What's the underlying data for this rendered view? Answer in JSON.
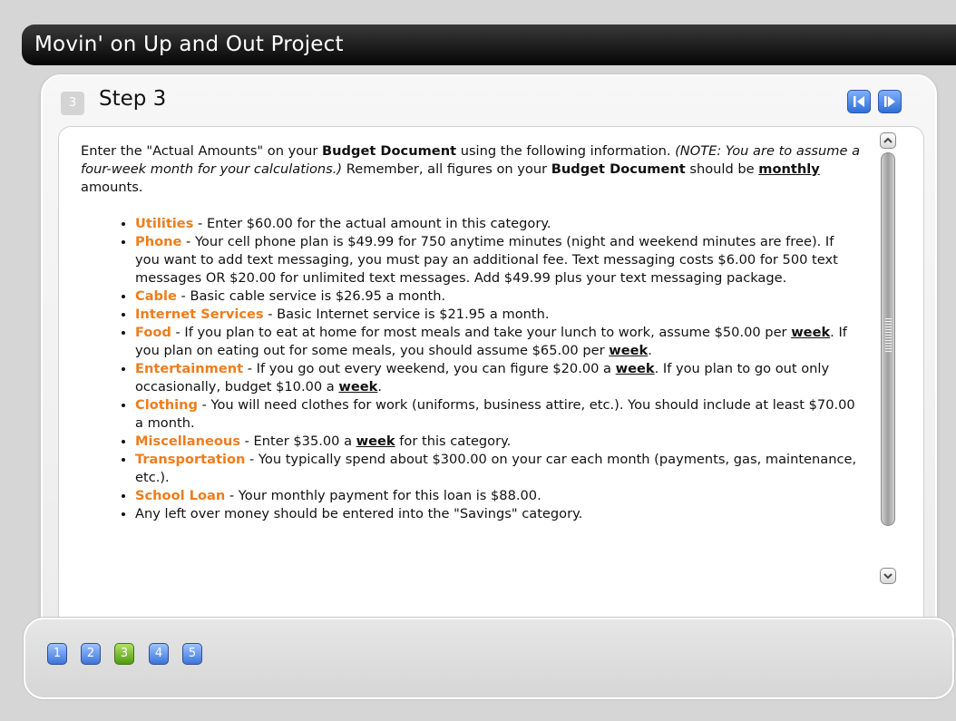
{
  "app": {
    "title": "Movin' on Up and Out Project"
  },
  "step": {
    "badge": "3",
    "heading": "Step 3"
  },
  "content": {
    "intro_1": "Enter the \"Actual Amounts\" on your ",
    "intro_bold_1": "Budget Document",
    "intro_2": " using the following information. ",
    "intro_note": "(NOTE:  You are to assume a four-week month for your calculations.)",
    "intro_3": "  Remember, all figures on your ",
    "intro_bold_2": "Budget Document",
    "intro_4": " should be ",
    "intro_underlined": "monthly",
    "intro_5": " amounts.",
    "items": [
      {
        "label": "Utilities",
        "text": " - Enter $60.00 for the actual amount in this category."
      },
      {
        "label": "Phone",
        "text": " - Your cell phone plan is $49.99 for 750 anytime minutes (night and weekend minutes are free).  If you want to add text messaging, you must pay an additional fee.  Text messaging costs $6.00 for 500 text messages OR $20.00 for unlimited text messages.  Add $49.99 plus your text messaging package."
      },
      {
        "label": "Cable",
        "text": " - Basic cable service is $26.95 a month."
      },
      {
        "label": "Internet Services",
        "text": " - Basic Internet service is $21.95 a month."
      },
      {
        "label": "Food",
        "text_a": " - If you plan to eat at home for most meals and take your lunch to work, assume $50.00 per ",
        "week": "week",
        "text_b": ".  If you plan on eating out for some meals, you should assume $65.00 per ",
        "week_2": "week",
        "text_c": "."
      },
      {
        "label": "Entertainment",
        "text_a": " - If you go out every weekend, you can figure $20.00 a ",
        "week": "week",
        "text_b": ".  If you plan to go out only occasionally, budget $10.00 a ",
        "week_2": "week",
        "text_c": "."
      },
      {
        "label": "Clothing",
        "text": " - You will need clothes for work (uniforms, business attire, etc.).  You should include at least $70.00 a month."
      },
      {
        "label": "Miscellaneous",
        "text_a": " - Enter $35.00 a ",
        "week": "week",
        "text_b": " for this category."
      },
      {
        "label": "Transportation",
        "text": " - You typically spend about $300.00 on your car each month (payments, gas, maintenance, etc.)."
      },
      {
        "label": "School Loan",
        "text": " - Your monthly payment for this loan is $88.00."
      },
      {
        "text": "Any left over money should be entered into the \"Savings\" category."
      }
    ]
  },
  "pagination": {
    "pages": [
      "1",
      "2",
      "3",
      "4",
      "5"
    ],
    "active": "3"
  },
  "colors": {
    "accent_orange": "#ee7d1c",
    "active_green": "#5aa21a",
    "button_blue": "#3d76d8"
  }
}
